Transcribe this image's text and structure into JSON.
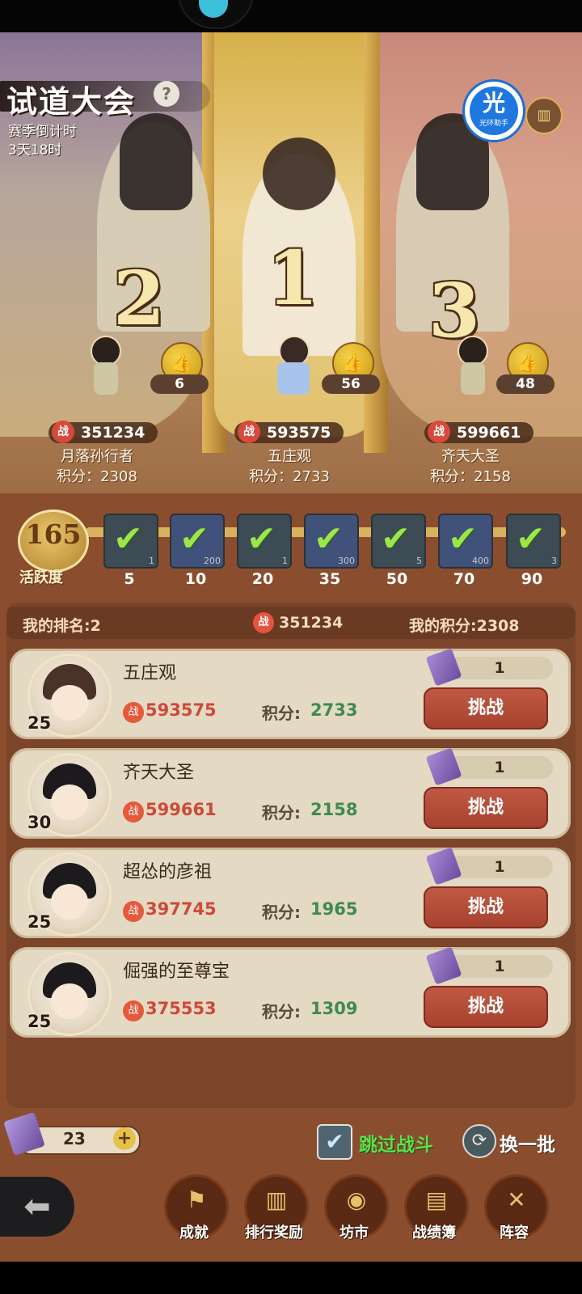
{
  "event": {
    "title": "试道大会",
    "help_icon": "?",
    "countdown_label": "赛季倒计时",
    "countdown_value": "3天18时"
  },
  "top_right": {
    "assistant_char": "光",
    "assistant_label": "光环助手",
    "rank_icon": "bar-chart-icon"
  },
  "podium": [
    {
      "rank": "2",
      "likes": "6",
      "power": "351234",
      "name": "月落孙行者",
      "score": "积分：2308"
    },
    {
      "rank": "1",
      "likes": "56",
      "power": "593575",
      "name": "五庄观",
      "score": "积分：2733"
    },
    {
      "rank": "3",
      "likes": "48",
      "power": "599661",
      "name": "齐天大圣",
      "score": "积分：2158"
    }
  ],
  "activity": {
    "value": "165",
    "label": "活跃度",
    "milestones": [
      {
        "threshold": "5",
        "small": "1",
        "claimed": true
      },
      {
        "threshold": "10",
        "small": "200",
        "claimed": true
      },
      {
        "threshold": "20",
        "small": "1",
        "claimed": true
      },
      {
        "threshold": "35",
        "small": "300",
        "claimed": true
      },
      {
        "threshold": "50",
        "small": "5",
        "claimed": true
      },
      {
        "threshold": "70",
        "small": "400",
        "claimed": true
      },
      {
        "threshold": "90",
        "small": "3",
        "claimed": true
      }
    ]
  },
  "my_status": {
    "rank": "我的排名:2",
    "power": "351234",
    "score": "我的积分:2308"
  },
  "power_glyph": "战",
  "opponents": [
    {
      "name": "五庄观",
      "level": "25",
      "power": "593575",
      "score_label": "积分:",
      "score": "2733",
      "tickets": "1",
      "button": "挑战"
    },
    {
      "name": "齐天大圣",
      "level": "30",
      "power": "599661",
      "score_label": "积分:",
      "score": "2158",
      "tickets": "1",
      "button": "挑战"
    },
    {
      "name": "超怂的彦祖",
      "level": "25",
      "power": "397745",
      "score_label": "积分:",
      "score": "1965",
      "tickets": "1",
      "button": "挑战"
    },
    {
      "name": "倔强的至尊宝",
      "level": "25",
      "power": "375553",
      "score_label": "积分:",
      "score": "1309",
      "tickets": "1",
      "button": "挑战"
    }
  ],
  "footer": {
    "tickets": "23",
    "add": "+",
    "skip_label": "跳过战斗",
    "refresh_label": "换一批"
  },
  "nav": [
    {
      "label": "成就",
      "icon": "banner-icon"
    },
    {
      "label": "排行奖励",
      "icon": "ranking-icon"
    },
    {
      "label": "坊市",
      "icon": "money-bag-icon"
    },
    {
      "label": "战绩簿",
      "icon": "scroll-icon"
    },
    {
      "label": "阵容",
      "icon": "formation-icon"
    }
  ],
  "colors": {
    "accent_green": "#5be04a",
    "power_red": "#cc4a3a",
    "score_green": "#3f8a52",
    "challenge_button": "#b04c37",
    "background_brown": "#8a4e2e"
  }
}
